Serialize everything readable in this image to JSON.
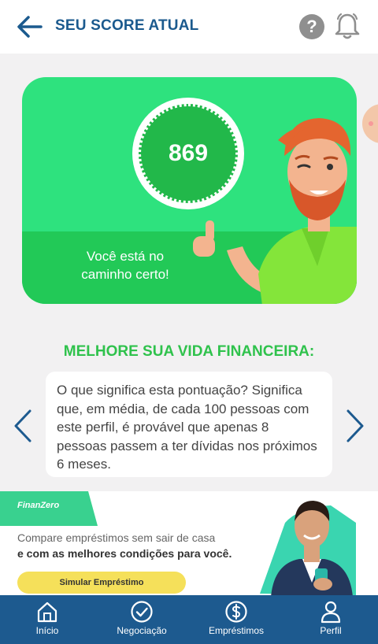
{
  "header": {
    "title": "SEU SCORE ATUAL",
    "help_icon": "question-circle-icon",
    "help_glyph": "?",
    "bell_icon": "bell-icon",
    "back_icon": "arrow-left-icon"
  },
  "score": {
    "value": "869",
    "message": "Você está no caminho certo!"
  },
  "section": {
    "title": "MELHORE SUA VIDA FINANCEIRA:"
  },
  "info_card": {
    "text": "O que significa esta pontuação? Significa que, em média, de cada 100 pessoas com este perfil, é provável que apenas 8 pessoas passem a ter dívidas nos próximos 6 meses."
  },
  "ad": {
    "logo": "FinanZero",
    "line1": "Compare empréstimos sem sair de casa",
    "line2": "e com as melhores condições para você.",
    "cta": "Simular Empréstimo"
  },
  "nav": {
    "items": [
      {
        "label": "Início",
        "icon": "home-icon"
      },
      {
        "label": "Negociação",
        "icon": "check-circle-icon"
      },
      {
        "label": "Empréstimos",
        "icon": "dollar-circle-icon"
      },
      {
        "label": "Perfil",
        "icon": "person-icon"
      }
    ]
  },
  "colors": {
    "brand_blue": "#1d5a8f",
    "score_green": "#2ee27e",
    "title_green": "#2fc24c",
    "ad_accent": "#f5e05a"
  }
}
